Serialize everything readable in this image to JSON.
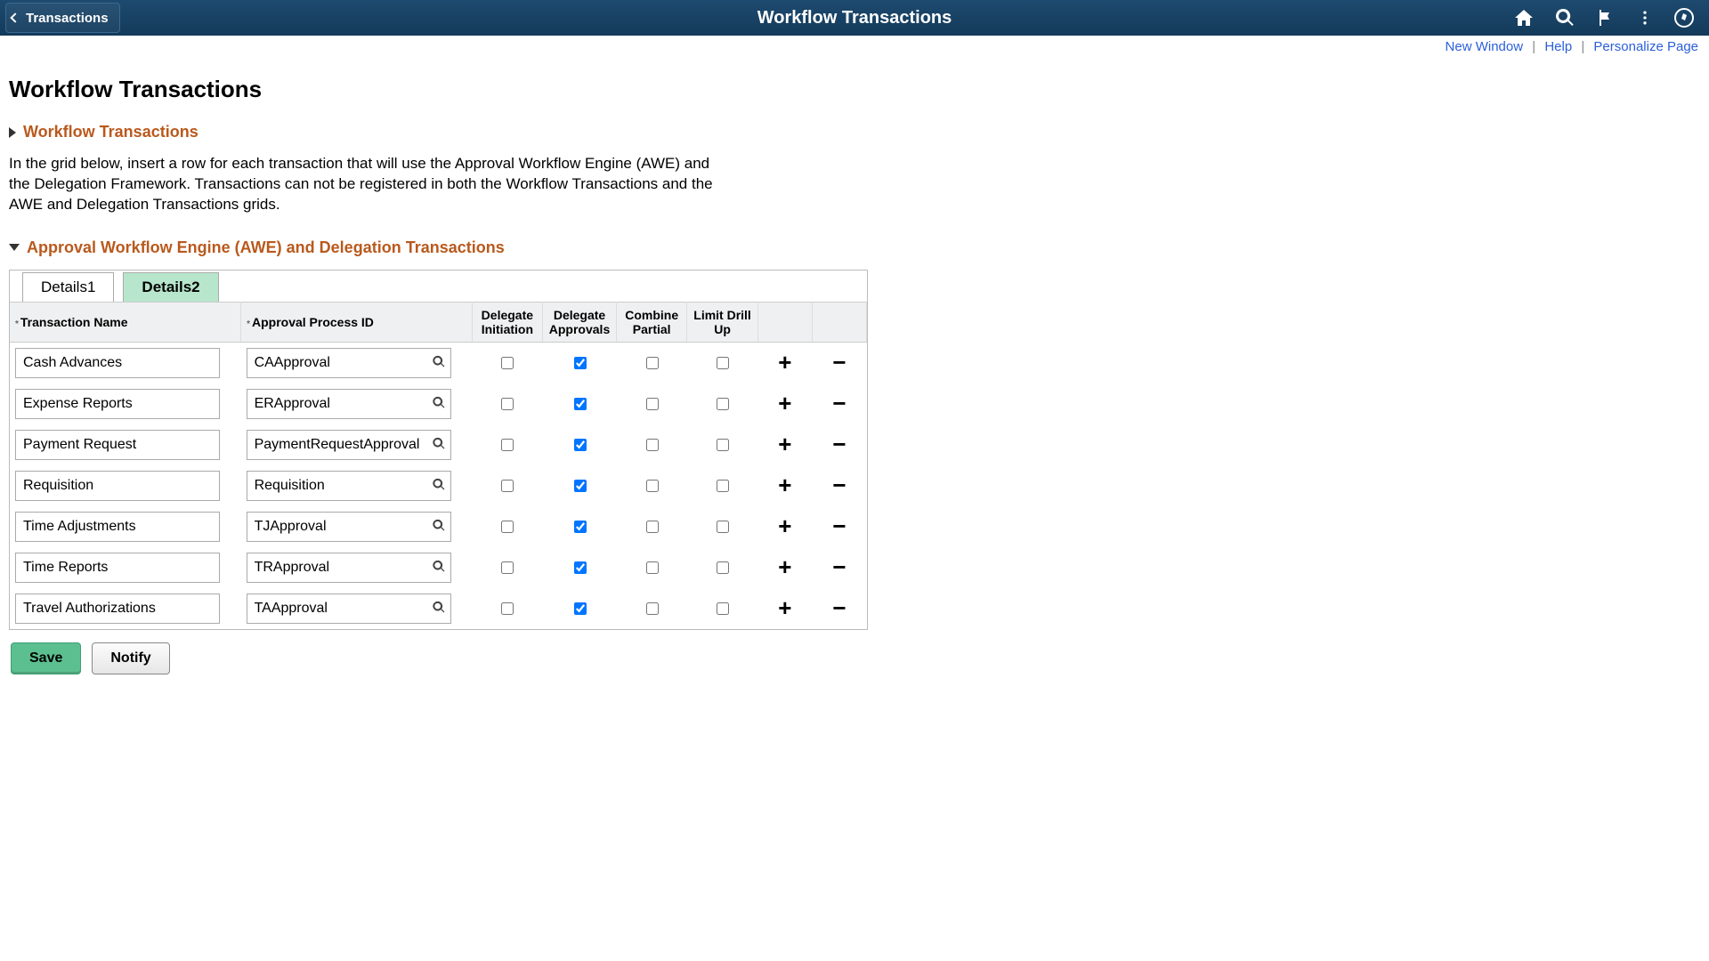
{
  "header": {
    "back_label": "Transactions",
    "title": "Workflow Transactions"
  },
  "links": {
    "new_window": "New Window",
    "help": "Help",
    "personalize": "Personalize Page"
  },
  "page": {
    "title": "Workflow Transactions",
    "section1_title": "Workflow Transactions",
    "instructions": "In the grid below, insert a row for each transaction that will use the Approval Workflow Engine (AWE) and the Delegation Framework. Transactions can not be registered in both the Workflow Transactions and the AWE and Delegation Transactions grids.",
    "section2_title": "Approval Workflow Engine (AWE) and Delegation Transactions"
  },
  "tabs": {
    "details1": "Details1",
    "details2": "Details2"
  },
  "columns": {
    "transaction_name": "Transaction Name",
    "approval_process_id": "Approval Process ID",
    "delegate_initiation": "Delegate Initiation",
    "delegate_approvals": "Delegate Approvals",
    "combine_partial": "Combine Partial",
    "limit_drill_up": "Limit Drill Up"
  },
  "rows": [
    {
      "transaction_name": "Cash Advances",
      "approval_process_id": "CAApproval",
      "delegate_initiation": false,
      "delegate_approvals": true,
      "combine_partial": false,
      "limit_drill_up": false
    },
    {
      "transaction_name": "Expense Reports",
      "approval_process_id": "ERApproval",
      "delegate_initiation": false,
      "delegate_approvals": true,
      "combine_partial": false,
      "limit_drill_up": false
    },
    {
      "transaction_name": "Payment Request",
      "approval_process_id": "PaymentRequestApproval",
      "delegate_initiation": false,
      "delegate_approvals": true,
      "combine_partial": false,
      "limit_drill_up": false
    },
    {
      "transaction_name": "Requisition",
      "approval_process_id": "Requisition",
      "delegate_initiation": false,
      "delegate_approvals": true,
      "combine_partial": false,
      "limit_drill_up": false
    },
    {
      "transaction_name": "Time Adjustments",
      "approval_process_id": "TJApproval",
      "delegate_initiation": false,
      "delegate_approvals": true,
      "combine_partial": false,
      "limit_drill_up": false
    },
    {
      "transaction_name": "Time Reports",
      "approval_process_id": "TRApproval",
      "delegate_initiation": false,
      "delegate_approvals": true,
      "combine_partial": false,
      "limit_drill_up": false
    },
    {
      "transaction_name": "Travel Authorizations",
      "approval_process_id": "TAApproval",
      "delegate_initiation": false,
      "delegate_approvals": true,
      "combine_partial": false,
      "limit_drill_up": false
    }
  ],
  "buttons": {
    "save": "Save",
    "notify": "Notify"
  }
}
